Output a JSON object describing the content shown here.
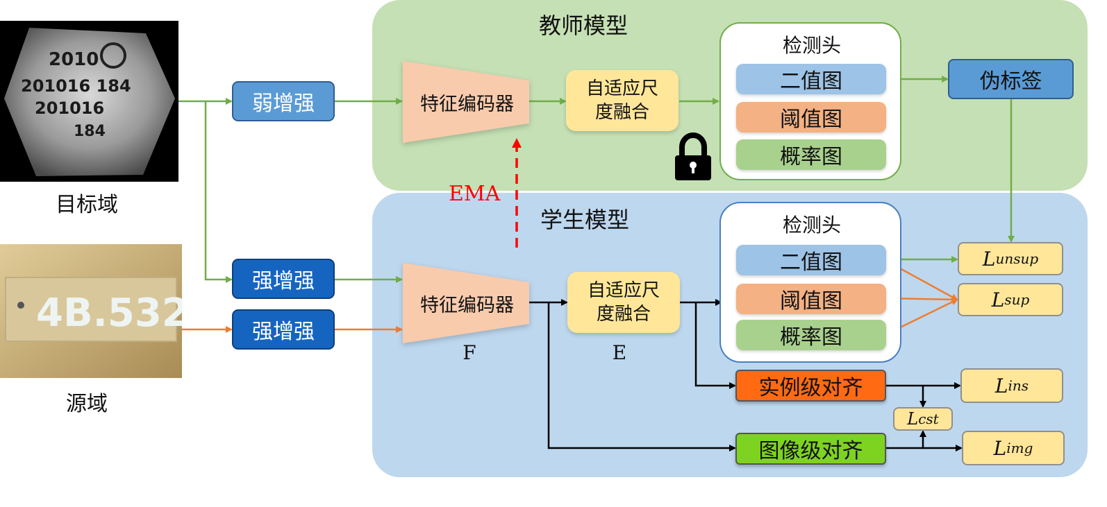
{
  "teacher": {
    "title": "教师模型"
  },
  "student": {
    "title": "学生模型"
  },
  "domains": {
    "target": "目标域",
    "source": "源域"
  },
  "target_image": {
    "lines": [
      "2010",
      "201016  184",
      "201016",
      "184"
    ]
  },
  "source_image": {
    "text": "4B.532"
  },
  "augment": {
    "weak": "弱增强",
    "strong_a": "强增强",
    "strong_b": "强增强"
  },
  "encoder": {
    "label": "特征编码器",
    "symbol": "F"
  },
  "fusion": {
    "label_1": "自适应尺",
    "label_2": "度融合",
    "symbol": "E"
  },
  "detection_head": {
    "title": "检测头",
    "binary": "二值图",
    "threshold": "阈值图",
    "probability": "概率图"
  },
  "pseudo_label": "伪标签",
  "ema": "EMA",
  "alignment": {
    "instance": "实例级对齐",
    "image": "图像级对齐"
  },
  "losses": {
    "unsup": {
      "base": "L",
      "sub": "unsup"
    },
    "sup": {
      "base": "L",
      "sub": "sup"
    },
    "ins": {
      "base": "L",
      "sub": "ins"
    },
    "cst": {
      "base": "L",
      "sub": "cst"
    },
    "img": {
      "base": "L",
      "sub": "img"
    }
  },
  "colors": {
    "teacher_bg": "#c5e0b4",
    "student_bg": "#bdd7ee",
    "green_arrow": "#70ad47",
    "orange_arrow": "#ed7d31",
    "ema_arrow": "#ff0000",
    "instance_align": "#ff6a13",
    "image_align": "#7ed321",
    "pseudo_label": "#5b9bd5"
  }
}
